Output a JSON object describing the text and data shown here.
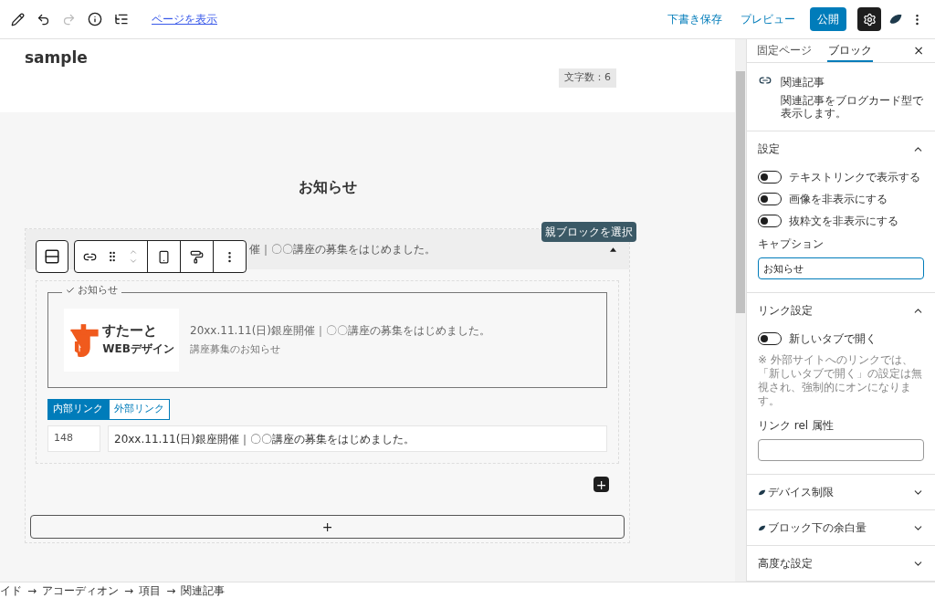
{
  "toolbar": {
    "view_page_link": "ページを表示",
    "save_draft": "下書き保存",
    "preview": "プレビュー",
    "publish": "公開",
    "settings_pressed": true
  },
  "editor": {
    "title": "sample",
    "char_count": "文字数：6",
    "heading": "お知らせ",
    "accordion": {
      "title_end": "催｜〇〇講座の募集をはじめました。",
      "expanded": true,
      "card": {
        "caption": "お知らせ",
        "logo_main": "すたーと",
        "logo_sub": "WEBデザイン",
        "title": "20xx.11.11(日)銀座開催｜〇〇講座の募集をはじめました。",
        "excerpt": "講座募集のお知らせ"
      },
      "link_tabs": [
        {
          "label": "内部リンク",
          "selected": true
        },
        {
          "label": "外部リンク",
          "selected": false
        }
      ],
      "post_id": "148",
      "post_title": "20xx.11.11(日)銀座開催｜〇〇講座の募集をはじめました。"
    },
    "select_parent_tooltip": "親ブロックを選択",
    "add_block": "+",
    "append_block": "+"
  },
  "sidebar": {
    "tabs": [
      {
        "label": "固定ページ",
        "selected": false
      },
      {
        "label": "ブロック",
        "selected": true
      }
    ],
    "close": "×",
    "block": {
      "name": "関連記事",
      "description": "関連記事をブログカード型で表示します。"
    },
    "panels": [
      {
        "title": "設定",
        "expanded": true,
        "has_brand_icon": false,
        "toggles": [
          {
            "label": "テキストリンクで表示する",
            "on": false
          },
          {
            "label": "画像を非表示にする",
            "on": false
          },
          {
            "label": "抜粋文を非表示にする",
            "on": false
          }
        ],
        "field_label": "キャプション",
        "field_value": "お知らせ",
        "field_focused": true
      },
      {
        "title": "リンク設定",
        "expanded": true,
        "has_brand_icon": false,
        "toggles": [
          {
            "label": "新しいタブで開く",
            "on": false
          }
        ],
        "note": "※ 外部サイトへのリンクでは、「新しいタブで開く」の設定は無視され、強制的にオンになります。",
        "field_label": "リンク rel 属性",
        "field_focused": false
      },
      {
        "title": "デバイス制限",
        "expanded": false,
        "has_brand_icon": true
      },
      {
        "title": "ブロック下の余白量",
        "expanded": false,
        "has_brand_icon": true
      },
      {
        "title": "高度な設定",
        "expanded": false,
        "has_brand_icon": false
      }
    ]
  },
  "breadcrumb": [
    "イド",
    "アコーディオン",
    "項目",
    "関連記事"
  ],
  "breadcrumb_separator": "→"
}
